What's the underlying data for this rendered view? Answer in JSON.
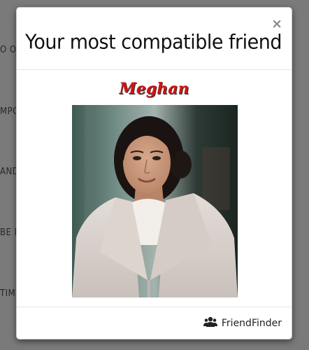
{
  "background": {
    "fragments": [
      "O OT",
      "MPO",
      "AND",
      "BE R",
      "TIM"
    ]
  },
  "modal": {
    "title": "Your most compatible friend",
    "close_label": "×",
    "friend": {
      "name": "Meghan",
      "name_color": "#d21414"
    },
    "footer": {
      "brand_label": "FriendFinder",
      "brand_icon": "users-icon"
    }
  }
}
